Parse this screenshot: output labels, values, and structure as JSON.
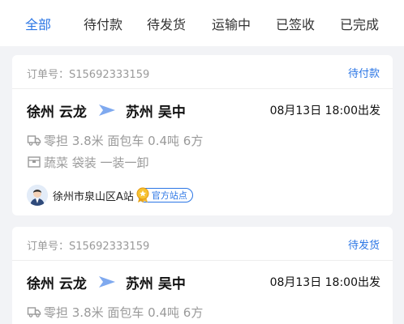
{
  "tabs": [
    {
      "label": "全部",
      "active": true
    },
    {
      "label": "待付款",
      "active": false
    },
    {
      "label": "待发货",
      "active": false
    },
    {
      "label": "运输中",
      "active": false
    },
    {
      "label": "已签收",
      "active": false
    },
    {
      "label": "已完成",
      "active": false
    }
  ],
  "orders": [
    {
      "order_no": "订单号：S15692333159",
      "status": "待付款",
      "from": "徐州 云龙",
      "to": "苏州 吴中",
      "time": "08月13日 18:00出发",
      "vehicle": "零担 3.8米 面包车 0.4吨 6方",
      "cargo": "蔬菜 袋装 一装一卸",
      "station": "徐州市泉山区A站",
      "badge": "官方站点"
    },
    {
      "order_no": "订单号：S15692333159",
      "status": "待发货",
      "from": "徐州 云龙",
      "to": "苏州 吴中",
      "time": "08月13日 18:00出发",
      "vehicle": "零担 3.8米 面包车 0.4吨 6方"
    }
  ],
  "colors": {
    "accent": "#2b76e5",
    "background": "#f2f3f6",
    "muted_text": "#9a9a9a"
  },
  "icons": {
    "route_arrow": "arrow-right-icon",
    "vehicle": "truck-icon",
    "cargo": "box-icon",
    "avatar": "user-avatar",
    "badge": "medal-icon"
  }
}
